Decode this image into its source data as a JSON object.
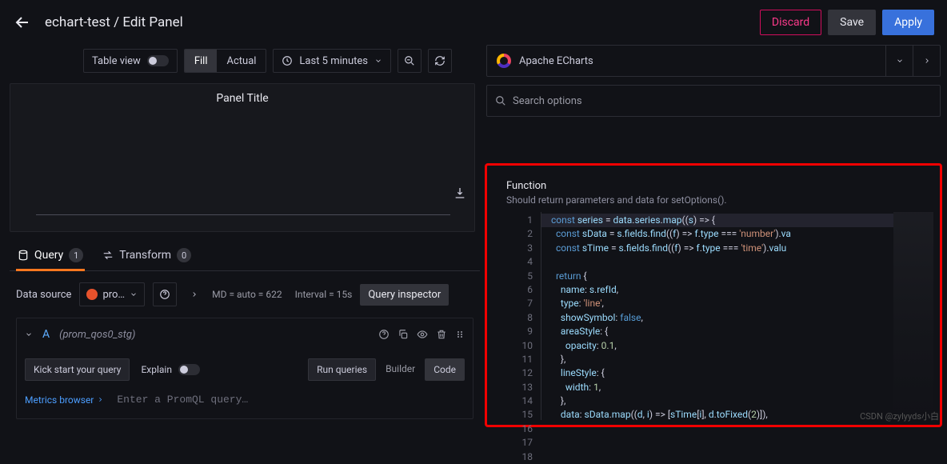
{
  "header": {
    "breadcrumb": "echart-test / Edit Panel",
    "discard": "Discard",
    "save": "Save",
    "apply": "Apply"
  },
  "controls": {
    "table_view": "Table view",
    "fill": "Fill",
    "actual": "Actual",
    "time_range": "Last 5 minutes"
  },
  "panel": {
    "title": "Panel Title"
  },
  "tabs": {
    "query": "Query",
    "query_badge": "1",
    "transform": "Transform",
    "transform_badge": "0"
  },
  "datasource": {
    "label": "Data source",
    "selected": "pro…",
    "md": "MD = auto = 622",
    "interval": "Interval = 15s",
    "inspector": "Query inspector"
  },
  "query": {
    "ref": "A",
    "name": "(prom_qos0_stg)",
    "kick": "Kick start your query",
    "explain": "Explain",
    "run": "Run queries",
    "builder": "Builder",
    "code": "Code",
    "metrics_browser": "Metrics browser",
    "placeholder": "Enter a PromQL query…"
  },
  "right": {
    "viz_name": "Apache ECharts",
    "search_placeholder": "Search options",
    "function_title": "Function",
    "function_sub": "Should return parameters and data for setOptions().",
    "code_lines": [
      "const series = data.series.map((s) => {",
      "  const sData = s.fields.find((f) => f.type === 'number').va",
      "  const sTime = s.fields.find((f) => f.type === 'time').valu",
      "",
      "  return {",
      "    name: s.refId,",
      "    type: 'line',",
      "    showSymbol: false,",
      "    areaStyle: {",
      "      opacity: 0.1,",
      "    },",
      "    lineStyle: {",
      "      width: 1,",
      "    },",
      "    data: sData.map((d, i) => [sTime[i], d.toFixed(2)]),",
      "  };",
      "});",
      ""
    ]
  },
  "watermark": "CSDN @zylyyds小白"
}
